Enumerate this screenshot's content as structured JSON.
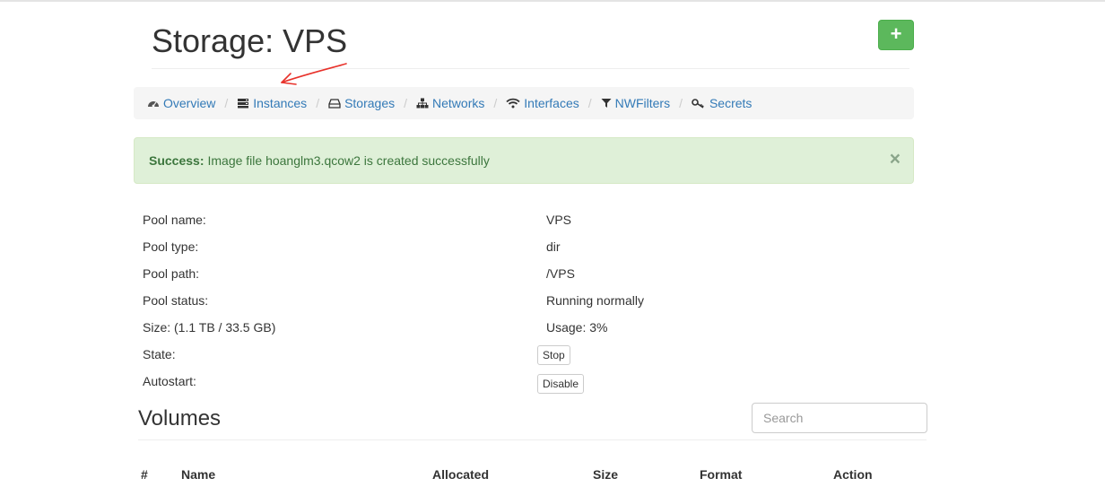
{
  "header": {
    "title": "Storage: VPS",
    "add_button": "+"
  },
  "nav": {
    "items": [
      {
        "label": "Overview",
        "icon": "dashboard-icon"
      },
      {
        "label": "Instances",
        "icon": "server-icon"
      },
      {
        "label": "Storages",
        "icon": "hdd-icon"
      },
      {
        "label": "Networks",
        "icon": "sitemap-icon"
      },
      {
        "label": "Interfaces",
        "icon": "wifi-icon"
      },
      {
        "label": "NWFilters",
        "icon": "filter-icon"
      },
      {
        "label": "Secrets",
        "icon": "key-icon"
      }
    ],
    "separator": "/"
  },
  "alert": {
    "strong": "Success:",
    "message": "Image file hoanglm3.qcow2 is created successfully",
    "close": "×"
  },
  "pool": {
    "name_label": "Pool name:",
    "name_value": "VPS",
    "type_label": "Pool type:",
    "type_value": "dir",
    "path_label": "Pool path:",
    "path_value": "/VPS",
    "status_label": "Pool status:",
    "status_value": "Running normally",
    "size_label": "Size: (1.1 TB / 33.5 GB)",
    "usage_value": "Usage: 3%",
    "state_label": "State:",
    "state_button": "Stop",
    "autostart_label": "Autostart:",
    "autostart_button": "Disable"
  },
  "volumes": {
    "title": "Volumes",
    "search_placeholder": "Search",
    "columns": [
      "#",
      "Name",
      "Allocated",
      "Size",
      "Format",
      "Action"
    ]
  },
  "colors": {
    "primary_link": "#337ab7",
    "success_btn": "#5cb85c",
    "alert_bg": "#dff0d8",
    "alert_text": "#3c763d",
    "annotation_arrow": "#e8322b"
  }
}
